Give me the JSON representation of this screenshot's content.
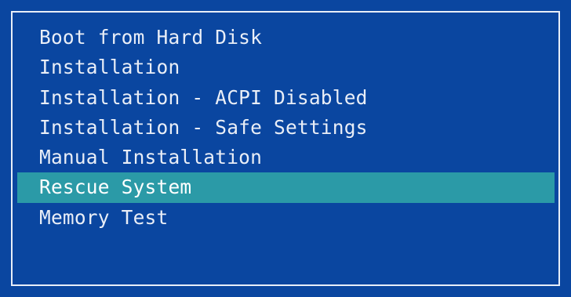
{
  "colors": {
    "background": "#0a46a0",
    "border": "#e8eef8",
    "text": "#e9eef7",
    "selection": "#2b9aa7"
  },
  "boot_menu": {
    "selected_index": 5,
    "items": [
      {
        "label": "Boot from Hard Disk"
      },
      {
        "label": "Installation"
      },
      {
        "label": "Installation - ACPI Disabled"
      },
      {
        "label": "Installation - Safe Settings"
      },
      {
        "label": "Manual Installation"
      },
      {
        "label": "Rescue System"
      },
      {
        "label": "Memory Test"
      }
    ]
  }
}
